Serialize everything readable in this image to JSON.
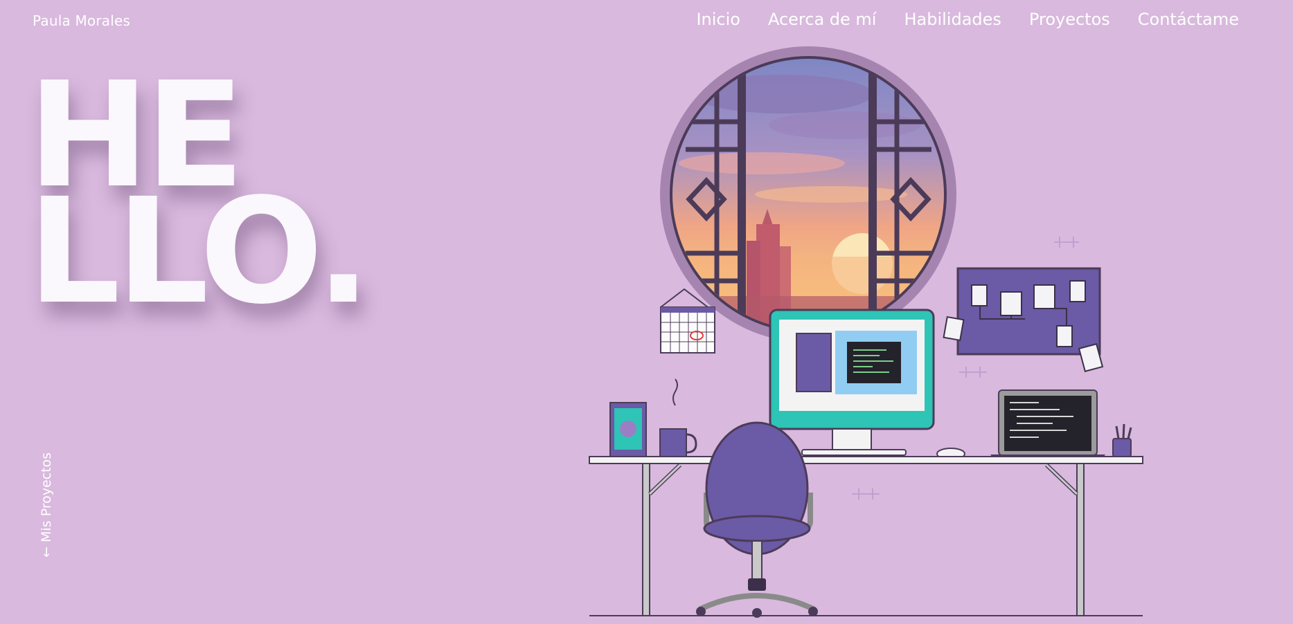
{
  "header": {
    "brand": "Paula Morales",
    "nav": [
      "Inicio",
      "Acerca de mí",
      "Habilidades",
      "Proyectos",
      "Contáctame"
    ]
  },
  "hero": {
    "line1": "HE",
    "line2": "LLO."
  },
  "side_link": {
    "arrow": "←",
    "label": "Mis Proyectos"
  },
  "colors": {
    "background": "#d9b9de",
    "accent_purple": "#6b5aa5",
    "teal": "#2ec4b6",
    "text": "#ffffff"
  }
}
